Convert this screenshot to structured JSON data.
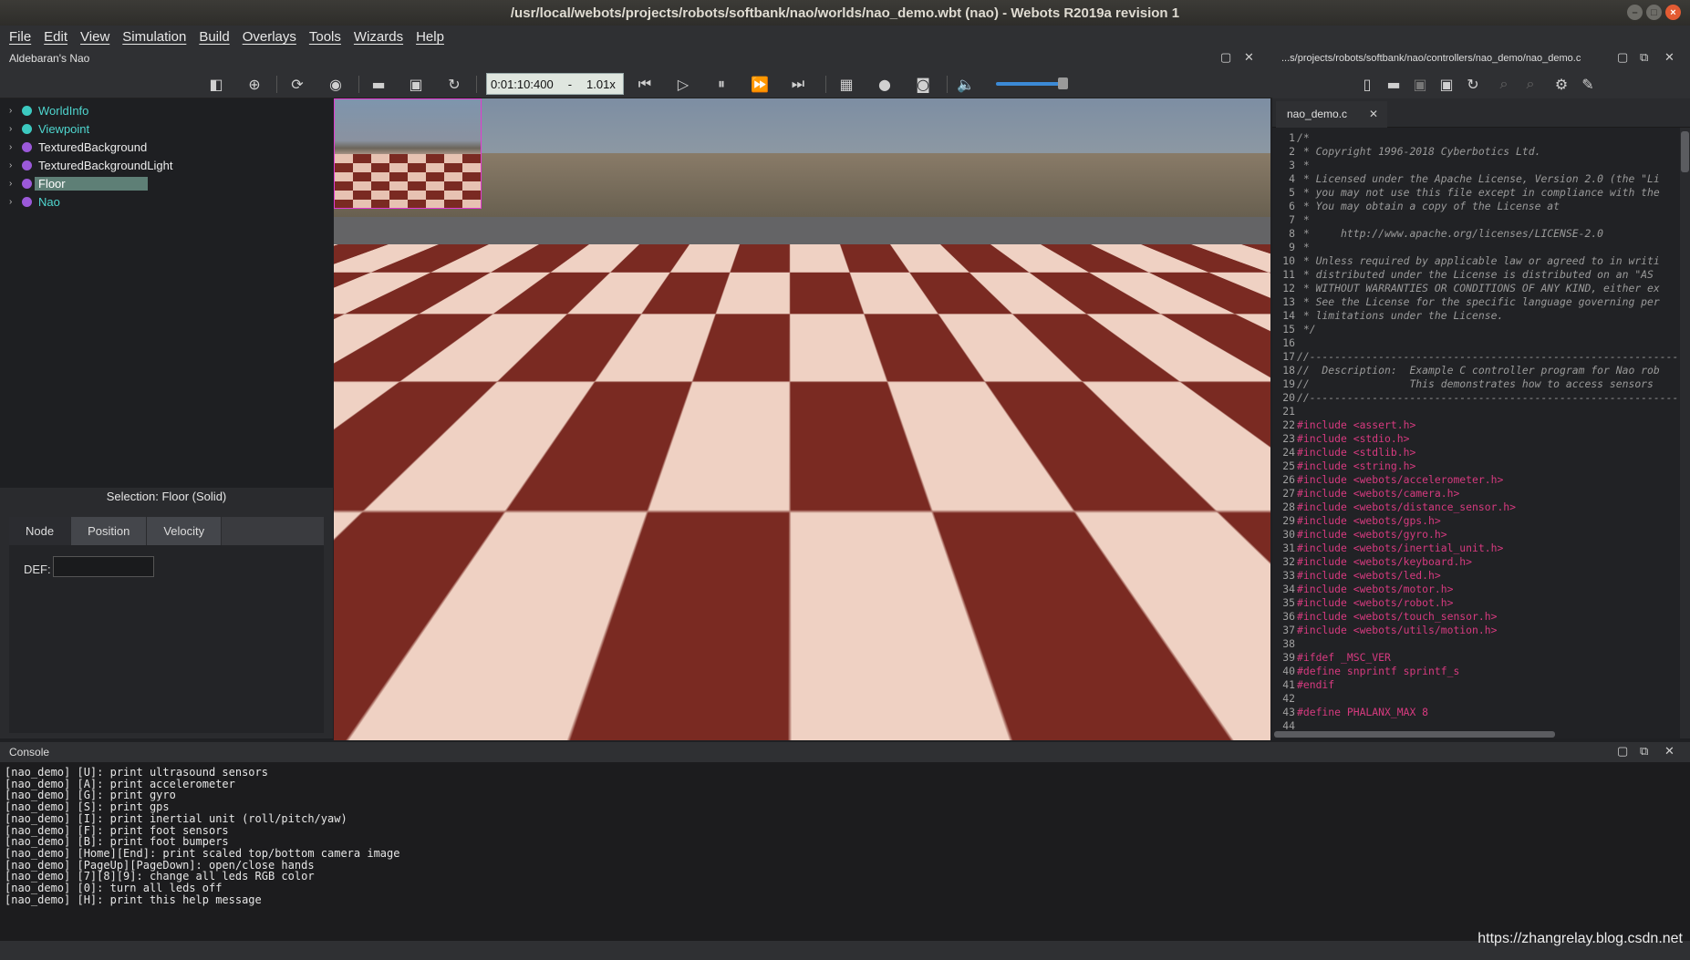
{
  "window": {
    "title": "/usr/local/webots/projects/robots/softbank/nao/worlds/nao_demo.wbt (nao) - Webots R2019a revision 1"
  },
  "menu": [
    "File",
    "Edit",
    "View",
    "Simulation",
    "Build",
    "Overlays",
    "Tools",
    "Wizards",
    "Help"
  ],
  "scene_dock": {
    "title": "Aldebaran's Nao"
  },
  "toolbar": {
    "time": "0:01:10:400",
    "speed_sep": "-",
    "speed": "1.01x",
    "volume_level": 0.85
  },
  "scene_tree": [
    {
      "label": "WorldInfo",
      "color": "#3cc9c0"
    },
    {
      "label": "Viewpoint",
      "color": "#3cc9c0"
    },
    {
      "label": "TexturedBackground",
      "color": "#9b59d9"
    },
    {
      "label": "TexturedBackgroundLight",
      "color": "#9b59d9"
    },
    {
      "label": "Floor",
      "color": "#9b59d9",
      "selected": true
    },
    {
      "label": "Nao",
      "color": "#9b59d9"
    }
  ],
  "properties": {
    "selection": "Selection: Floor (Solid)",
    "tabs": [
      "Node",
      "Position",
      "Velocity"
    ],
    "def_label": "DEF:",
    "def_value": ""
  },
  "editor": {
    "path": "...s/projects/robots/softbank/nao/controllers/nao_demo/nao_demo.c",
    "tab": "nao_demo.c",
    "lines": [
      {
        "n": "1",
        "t": "/*",
        "k": "c"
      },
      {
        "n": "2",
        "t": " * Copyright 1996-2018 Cyberbotics Ltd.",
        "k": "c"
      },
      {
        "n": "3",
        "t": " *",
        "k": "c"
      },
      {
        "n": "4",
        "t": " * Licensed under the Apache License, Version 2.0 (the \"Li",
        "k": "c"
      },
      {
        "n": "5",
        "t": " * you may not use this file except in compliance with the",
        "k": "c"
      },
      {
        "n": "6",
        "t": " * You may obtain a copy of the License at",
        "k": "c"
      },
      {
        "n": "7",
        "t": " *",
        "k": "c"
      },
      {
        "n": "8",
        "t": " *     http://www.apache.org/licenses/LICENSE-2.0",
        "k": "c"
      },
      {
        "n": "9",
        "t": " *",
        "k": "c"
      },
      {
        "n": "10",
        "t": " * Unless required by applicable law or agreed to in writi",
        "k": "c"
      },
      {
        "n": "11",
        "t": " * distributed under the License is distributed on an \"AS",
        "k": "c"
      },
      {
        "n": "12",
        "t": " * WITHOUT WARRANTIES OR CONDITIONS OF ANY KIND, either ex",
        "k": "c"
      },
      {
        "n": "13",
        "t": " * See the License for the specific language governing per",
        "k": "c"
      },
      {
        "n": "14",
        "t": " * limitations under the License.",
        "k": "c"
      },
      {
        "n": "15",
        "t": " */",
        "k": "c"
      },
      {
        "n": "16",
        "t": "",
        "k": "c"
      },
      {
        "n": "17",
        "t": "//-----------------------------------------------------------",
        "k": "c"
      },
      {
        "n": "18",
        "t": "//  Description:  Example C controller program for Nao rob",
        "k": "c"
      },
      {
        "n": "19",
        "t": "//                This demonstrates how to access sensors",
        "k": "c"
      },
      {
        "n": "20",
        "t": "//-----------------------------------------------------------",
        "k": "c"
      },
      {
        "n": "21",
        "t": "",
        "k": "c"
      },
      {
        "n": "22",
        "t": "#include <assert.h>",
        "k": "i"
      },
      {
        "n": "23",
        "t": "#include <stdio.h>",
        "k": "i"
      },
      {
        "n": "24",
        "t": "#include <stdlib.h>",
        "k": "i"
      },
      {
        "n": "25",
        "t": "#include <string.h>",
        "k": "i"
      },
      {
        "n": "26",
        "t": "#include <webots/accelerometer.h>",
        "k": "i"
      },
      {
        "n": "27",
        "t": "#include <webots/camera.h>",
        "k": "i"
      },
      {
        "n": "28",
        "t": "#include <webots/distance_sensor.h>",
        "k": "i"
      },
      {
        "n": "29",
        "t": "#include <webots/gps.h>",
        "k": "i"
      },
      {
        "n": "30",
        "t": "#include <webots/gyro.h>",
        "k": "i"
      },
      {
        "n": "31",
        "t": "#include <webots/inertial_unit.h>",
        "k": "i"
      },
      {
        "n": "32",
        "t": "#include <webots/keyboard.h>",
        "k": "i"
      },
      {
        "n": "33",
        "t": "#include <webots/led.h>",
        "k": "i"
      },
      {
        "n": "34",
        "t": "#include <webots/motor.h>",
        "k": "i"
      },
      {
        "n": "35",
        "t": "#include <webots/robot.h>",
        "k": "i"
      },
      {
        "n": "36",
        "t": "#include <webots/touch_sensor.h>",
        "k": "i"
      },
      {
        "n": "37",
        "t": "#include <webots/utils/motion.h>",
        "k": "i"
      },
      {
        "n": "38",
        "t": "",
        "k": "c"
      },
      {
        "n": "39",
        "t": "#ifdef _MSC_VER",
        "k": "i"
      },
      {
        "n": "40",
        "t": "#define snprintf sprintf_s",
        "k": "i"
      },
      {
        "n": "41",
        "t": "#endif",
        "k": "i"
      },
      {
        "n": "42",
        "t": "",
        "k": "c"
      },
      {
        "n": "43",
        "t": "#define PHALANX_MAX 8",
        "k": "i"
      },
      {
        "n": "44",
        "t": "",
        "k": "c"
      }
    ]
  },
  "console": {
    "title": "Console",
    "lines": [
      "[nao_demo] [U]: print ultrasound sensors",
      "[nao_demo] [A]: print accelerometer",
      "[nao_demo] [G]: print gyro",
      "[nao_demo] [S]: print gps",
      "[nao_demo] [I]: print inertial unit (roll/pitch/yaw)",
      "[nao_demo] [F]: print foot sensors",
      "[nao_demo] [B]: print foot bumpers",
      "[nao_demo] [Home][End]: print scaled top/bottom camera image",
      "[nao_demo] [PageUp][PageDown]: open/close hands",
      "[nao_demo] [7][8][9]: change all leds RGB color",
      "[nao_demo] [0]: turn all leds off",
      "[nao_demo] [H]: print this help message"
    ]
  },
  "watermark": "https://zhangrelay.blog.csdn.net"
}
